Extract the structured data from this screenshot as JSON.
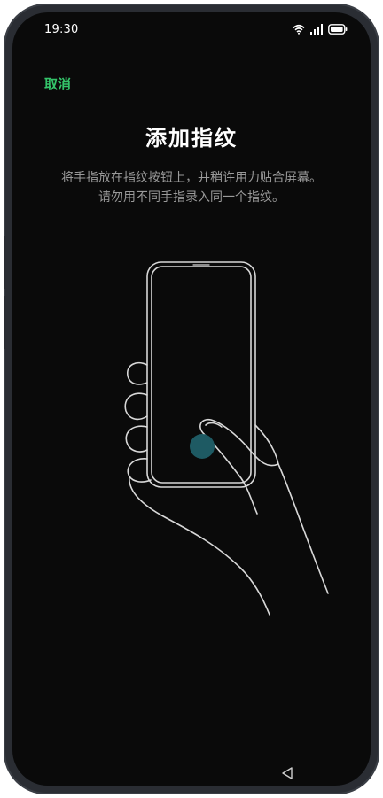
{
  "status_bar": {
    "time": "19:30",
    "icons": [
      "wifi-icon",
      "signal-icon",
      "battery-icon"
    ]
  },
  "header": {
    "cancel_label": "取消",
    "title": "添加指纹"
  },
  "instructions": {
    "line1": "将手指放在指纹按钮上，并稍许用力贴合屏幕。",
    "line2": "请勿用不同手指录入同一个指纹。"
  },
  "illustration": {
    "name": "phone-in-hand-illustration",
    "fingerprint_marker_color": "#1e5a63"
  },
  "nav": {
    "back_icon": "triangle-back-icon"
  },
  "colors": {
    "background": "#0a0a0a",
    "accent": "#34c46a",
    "title": "#ffffff",
    "body_text": "#9a9a9a"
  }
}
